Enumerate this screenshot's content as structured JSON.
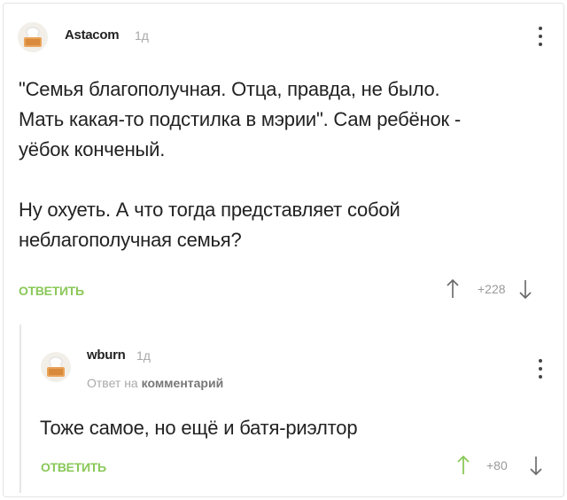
{
  "comments": [
    {
      "user": "Astacom",
      "time": "1д",
      "text": "\"Семья благополучная. Отца, правда, не было.\nМать какая-то подстилка в мэрии\". Сам ребёнок -\nуёбок конченый.\n\nНу охуеть. А что тогда представляет собой\nнеблагополучная семья?",
      "reply_label": "ОТВЕТИТЬ",
      "score": "+228"
    },
    {
      "user": "wburn",
      "time": "1д",
      "reply_to_prefix": "Ответ на",
      "reply_to_target": "комментарий",
      "text": "Тоже самое, но ещё и батя-риэлтор",
      "reply_label": "ОТВЕТИТЬ",
      "score": "+80"
    }
  ],
  "icons": {
    "upvote": "arrow-up-icon",
    "downvote": "arrow-down-icon",
    "menu": "more-vertical-icon"
  },
  "colors": {
    "accent_green": "#8ac858",
    "upvoted_green": "#8ac858",
    "muted": "#a7a7a7"
  }
}
